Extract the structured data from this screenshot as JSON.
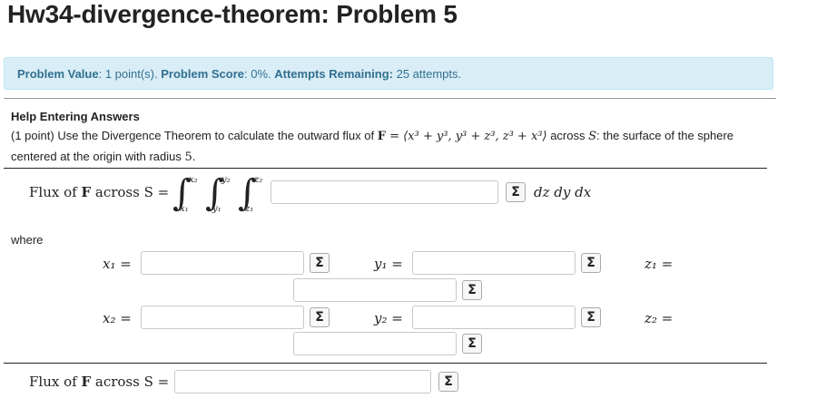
{
  "page": {
    "title": "Hw34-divergence-theorem: Problem 5"
  },
  "status": {
    "value_label": "Problem Value",
    "value_text": ": 1 point(s). ",
    "score_label": "Problem Score",
    "score_text": ": 0%. ",
    "attempts_label": "Attempts Remaining:",
    "attempts_text": " 25 attempts."
  },
  "problem": {
    "help_link": "Help Entering Answers",
    "points": "(1 point)",
    "text_a": " Use the Divergence Theorem to calculate the outward flux of ",
    "F": "F",
    "field": " = ⟨x³ + y³, y³ + z³, z³ + x³⟩",
    "text_b": " across ",
    "S": "S",
    "text_c": ": the surface of the sphere centered at the origin with radius ",
    "radius": "5",
    "period": "."
  },
  "integral": {
    "lhs_pre": "Flux of ",
    "lhs_F": "F",
    "lhs_post": " across S =",
    "upper": [
      "x₂",
      "y₂",
      "z₂"
    ],
    "lower": [
      "x₁",
      "y₁",
      "z₁"
    ],
    "integrand_placeholder": "",
    "differentials": "dz dy dx"
  },
  "limits": {
    "where": "where",
    "x1": "x₁ =",
    "y1": "y₁ =",
    "z1": "z₁ =",
    "x2": "x₂ =",
    "y2": "y₂ =",
    "z2": "z₂ ="
  },
  "final": {
    "lhs_pre": "Flux of ",
    "lhs_F": "F",
    "lhs_post": " across S ="
  },
  "equation_button": "Σ"
}
